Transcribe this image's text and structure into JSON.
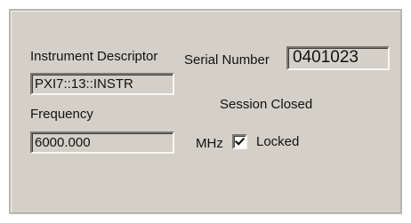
{
  "instrument_descriptor": {
    "label": "Instrument Descriptor",
    "value": "PXI7::13::INSTR"
  },
  "serial_number": {
    "label": "Serial Number",
    "value": "0401023"
  },
  "frequency": {
    "label": "Frequency",
    "value": "6000.000",
    "unit": "MHz"
  },
  "session_status": "Session Closed",
  "locked": {
    "label": "Locked",
    "checked": true
  },
  "icons": {
    "checkmark": "check-icon"
  },
  "colors": {
    "panel_background": "#d4d0c8",
    "checkbox_background": "#ffffff",
    "text": "#111111"
  }
}
